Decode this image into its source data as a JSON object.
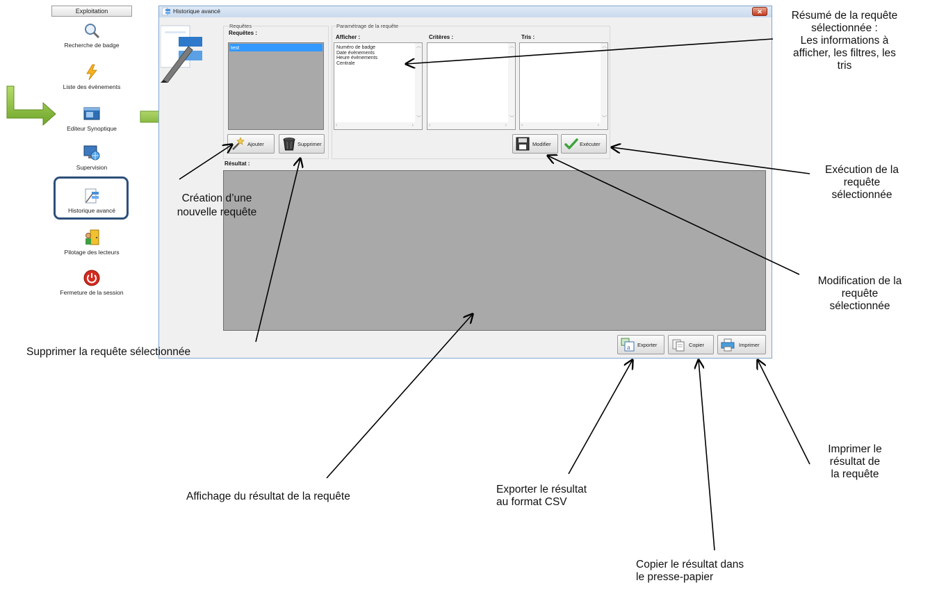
{
  "nav": {
    "title": "Exploitation",
    "items": [
      {
        "label": "Recherche de badge",
        "icon": "magnifier-icon"
      },
      {
        "label": "Liste des évènements",
        "icon": "lightning-icon"
      },
      {
        "label": "Editeur Synoptique",
        "icon": "monitor-window-icon"
      },
      {
        "label": "Supervision",
        "icon": "monitor-globe-icon"
      },
      {
        "label": "Historique avancé",
        "icon": "history-document-icon"
      },
      {
        "label": "Pilotage des lecteurs",
        "icon": "door-person-icon"
      },
      {
        "label": "Fermeture de la session",
        "icon": "power-icon"
      }
    ]
  },
  "window": {
    "title": "Historique avancé",
    "close": "✕",
    "requests_group": "Requêtes",
    "requests_label": "Requêtes :",
    "requests": [
      "test"
    ],
    "params_group": "Paramétrage de la requête",
    "afficher_label": "Afficher :",
    "afficher_items": [
      "Numéro de badge",
      "Date évènements",
      "Heure évènements",
      "Centrale"
    ],
    "criteres_label": "Critères :",
    "tris_label": "Tris :",
    "add_button": "Ajouter",
    "delete_button": "Supprimer",
    "modify_button": "Modifier",
    "execute_button": "Exécuter",
    "result_label": "Résultat :",
    "export_button": "Exporter",
    "copy_button": "Copier",
    "print_button": "Imprimer"
  },
  "annotations": {
    "summary": [
      "Résumé de la requête",
      "sélectionnée :",
      "Les informations à",
      "afficher, les filtres, les",
      "tris"
    ],
    "execute": [
      "Exécution de la",
      "requête",
      "sélectionnée"
    ],
    "create": [
      "Création d’une",
      "nouvelle requête"
    ],
    "modify": [
      "Modification de la",
      "requête",
      "sélectionnée"
    ],
    "delete": "Supprimer la requête sélectionnée",
    "display": "Affichage du résultat de la requête",
    "export": [
      "Exporter le résultat",
      "au format CSV"
    ],
    "print": [
      "Imprimer le",
      "résultat de",
      "la requête"
    ],
    "copy": [
      "Copier le résultat dans",
      "le presse-papier"
    ]
  },
  "colors": {
    "selection": "#3399ff",
    "result_background": "#a9a9a9",
    "nav_highlight": "#2c4f78",
    "green_arrow": "#8dc63f"
  }
}
